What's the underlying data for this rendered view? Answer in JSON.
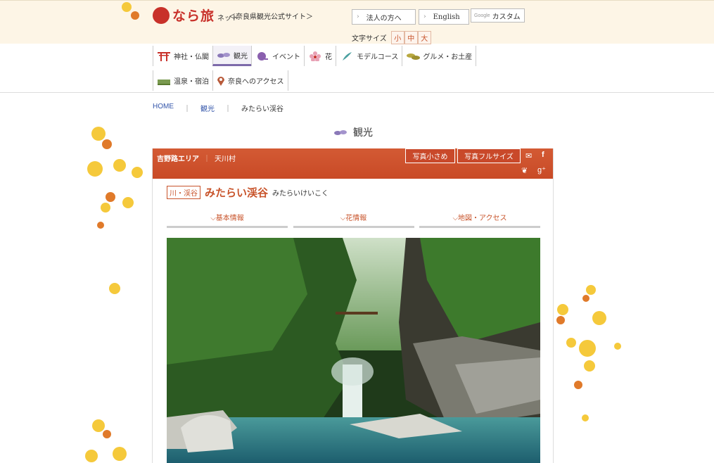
{
  "header": {
    "logo_name": "なら旅",
    "logo_net": "ネット",
    "tagline": "＜奈良県観光公式サイト＞",
    "corporate_label": "法人の方へ",
    "english_label": "English",
    "search_provider": "Google",
    "search_label": "カスタム",
    "font_size_label": "文字サイズ",
    "font_sizes": [
      "小",
      "中",
      "大"
    ]
  },
  "nav": {
    "items": [
      {
        "label": "神社・仏閣",
        "icon": "torii-icon"
      },
      {
        "label": "観光",
        "icon": "sightseeing-icon",
        "active": true
      },
      {
        "label": "イベント",
        "icon": "event-icon"
      },
      {
        "label": "花",
        "icon": "flower-icon"
      },
      {
        "label": "モデルコース",
        "icon": "model-course-icon"
      },
      {
        "label": "グルメ・お土産",
        "icon": "gourmet-icon"
      },
      {
        "label": "温泉・宿泊",
        "icon": "onsen-icon"
      },
      {
        "label": "奈良へのアクセス",
        "icon": "map-pin-icon"
      }
    ]
  },
  "breadcrumb": [
    "HOME",
    "観光",
    "みたらい渓谷"
  ],
  "page_title": "観光",
  "spot": {
    "area": "吉野路エリア",
    "village": "天川村",
    "photo_small_label": "写真小さめ",
    "photo_full_label": "写真フルサイズ",
    "category": "川・渓谷",
    "name": "みたらい渓谷",
    "reading": "みたらいけいこく",
    "tabs": [
      "基本情報",
      "花情報",
      "地図・アクセス"
    ]
  },
  "colors": {
    "accent": "#c8532a",
    "header_bg": "#fdf5e6",
    "nav_active": "#7d6aaa"
  }
}
